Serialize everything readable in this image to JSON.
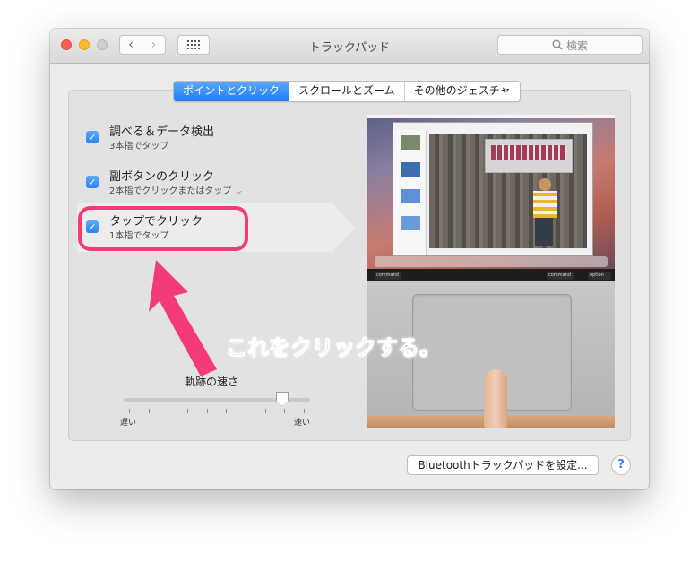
{
  "window": {
    "title": "トラックパッド",
    "search_placeholder": "検索"
  },
  "tabs": [
    {
      "label": "ポイントとクリック",
      "active": true
    },
    {
      "label": "スクロールとズーム",
      "active": false
    },
    {
      "label": "その他のジェスチャ",
      "active": false
    }
  ],
  "options": [
    {
      "title": "調べる＆データ検出",
      "subtitle": "3本指でタップ",
      "checked": true
    },
    {
      "title": "副ボタンのクリック",
      "subtitle": "2本指でクリックまたはタップ",
      "checked": true,
      "has_dropdown": true
    },
    {
      "title": "タップでクリック",
      "subtitle": "1本指でタップ",
      "checked": true,
      "selected": true
    }
  ],
  "slider": {
    "label": "軌跡の速さ",
    "min_label": "遅い",
    "max_label": "速い",
    "value_fraction": 0.85
  },
  "preview_keys": {
    "command_left": "command",
    "command_right": "command",
    "option_right": "option"
  },
  "buttons": {
    "bluetooth": "Bluetoothトラックパッドを設定...",
    "help": "?"
  },
  "annotation": {
    "text": "これをクリックする。",
    "color": "#f33b78"
  },
  "colors": {
    "accent": "#2a83f5",
    "close": "#fc5f57",
    "minimize": "#fdbc2e"
  }
}
